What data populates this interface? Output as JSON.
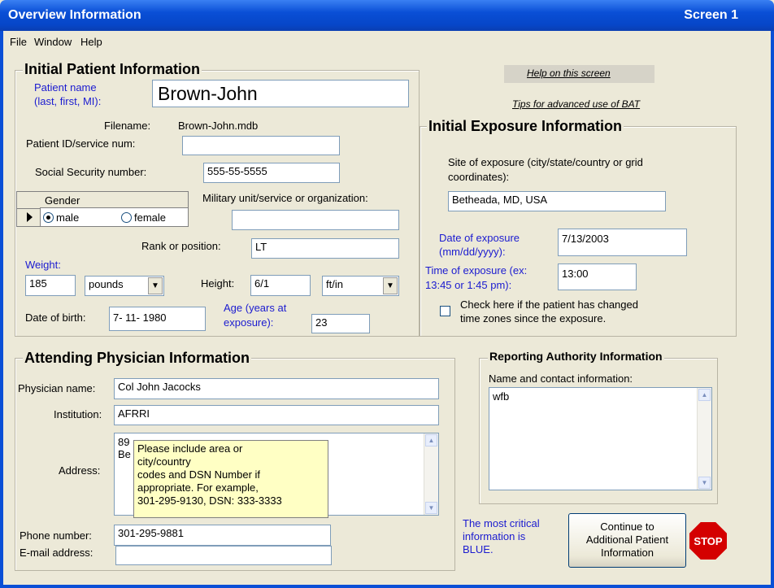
{
  "window": {
    "title": "Overview Information",
    "screen_label": "Screen  1"
  },
  "menu": [
    "File",
    "Window",
    "Help"
  ],
  "patient": {
    "section_title": "Initial Patient Information",
    "name_label_1": "Patient name",
    "name_label_2": "(last, first, MI):",
    "name_value": "Brown-John",
    "filename_label": "Filename:",
    "filename_value": "Brown-John.mdb",
    "id_label": "Patient ID/service num:",
    "id_value": "",
    "ssn_label": "Social Security number:",
    "ssn_value": "555-55-5555",
    "gender_header": "Gender",
    "gender_options": [
      "male",
      "female"
    ],
    "gender_selected": "male",
    "military_label": "Military unit/service or organization:",
    "military_value": "",
    "rank_label": "Rank or position:",
    "rank_value": "LT",
    "weight_label": "Weight:",
    "weight_value": "185",
    "weight_unit": "pounds",
    "height_label": "Height:",
    "height_value": "6/1",
    "height_unit": "ft/in",
    "dob_label": "Date of birth:",
    "dob_value": "7- 11- 1980",
    "age_label_1": "Age (years at",
    "age_label_2": "exposure):",
    "age_value": "23"
  },
  "links": {
    "help": "Help on this screen",
    "tips": "Tips for advanced use of BAT"
  },
  "exposure": {
    "section_title": "Initial Exposure Information",
    "site_label_1": "Site of exposure (city/state/country or grid",
    "site_label_2": "coordinates):",
    "site_value": "Betheada, MD, USA",
    "date_label_1": "Date of exposure",
    "date_label_2": "(mm/dd/yyyy):",
    "date_value": "7/13/2003",
    "time_label_1": "Time of exposure  (ex:",
    "time_label_2": "13:45 or 1:45 pm):",
    "time_value": "13:00",
    "tz_label_1": "Check here if the patient has changed",
    "tz_label_2": "time zones since the exposure."
  },
  "physician": {
    "section_title": "Attending Physician Information",
    "name_label": "Physician name:",
    "name_value": "Col John Jacocks",
    "inst_label": "Institution:",
    "inst_value": "AFRRI",
    "address_label": "Address:",
    "address_line1": "89",
    "address_line2": "Be",
    "tooltip_lines": [
      "Please include area or",
      "city/country",
      "codes and DSN Number if",
      "appropriate.  For example,",
      "301-295-9130, DSN: 333-3333"
    ],
    "phone_label": "Phone number:",
    "phone_value": "301-295-9881",
    "email_label": "E-mail address:",
    "email_value": ""
  },
  "reporting": {
    "section_title": "Reporting Authority Information",
    "contact_label": "Name and contact information:",
    "contact_value": "wfb"
  },
  "footer": {
    "critical_1": "The most critical",
    "critical_2": "information is",
    "critical_3": "BLUE.",
    "continue_1": "Continue to",
    "continue_2": "Additional Patient",
    "continue_3": "Information",
    "stop_text": "STOP"
  },
  "colors": {
    "title_bar": "#0a4fd6",
    "critical_text": "#1b1bd0",
    "tooltip_bg": "#ffffc4",
    "stop_red": "#d40000"
  }
}
